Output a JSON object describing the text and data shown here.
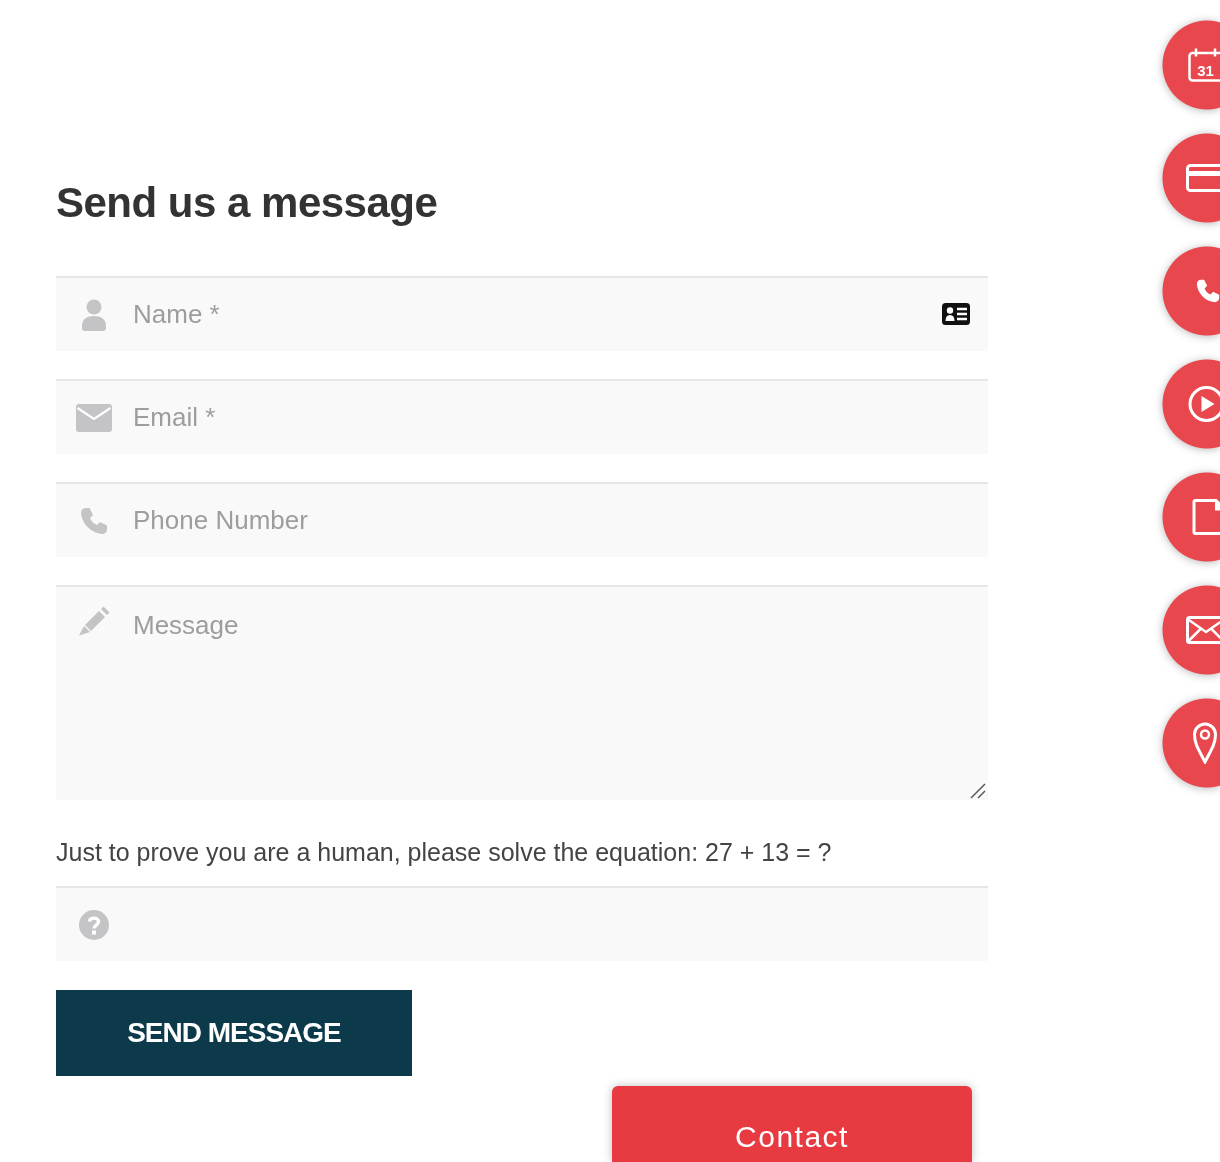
{
  "heading": "Send us a message",
  "fields": [
    {
      "kind": "name",
      "placeholder": "Name *",
      "autofill": true
    },
    {
      "kind": "email",
      "placeholder": "Email *"
    },
    {
      "kind": "phone",
      "placeholder": "Phone Number"
    },
    {
      "kind": "message",
      "placeholder": "Message"
    }
  ],
  "captcha": {
    "question": "Just to prove you are a human, please solve the equation: 27 + 13 = ?"
  },
  "submit_button": "SEND MESSAGE",
  "side_buttons": [
    {
      "kind": "calendar",
      "label": "31"
    },
    {
      "kind": "card"
    },
    {
      "kind": "phone"
    },
    {
      "kind": "play"
    },
    {
      "kind": "document"
    },
    {
      "kind": "mail"
    },
    {
      "kind": "pin"
    }
  ],
  "contact_tab": "Contact"
}
